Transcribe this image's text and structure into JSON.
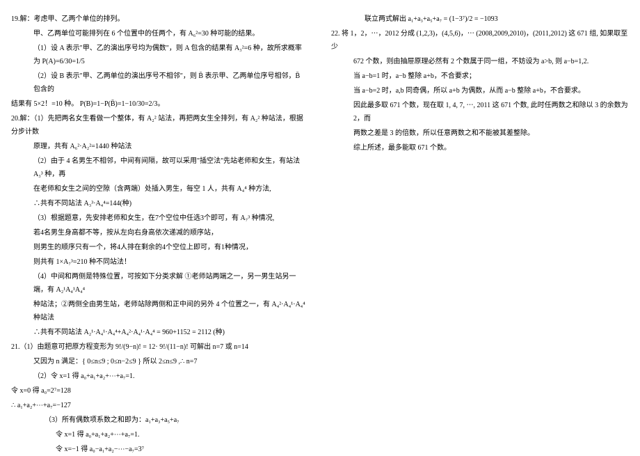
{
  "left": {
    "p19": {
      "head": "19.解：考虑甲、乙两个单位的排列。",
      "l1": "甲、乙两单位可能排列在 6 个位置中的任两个，有 A₆²=30 种可能的结果。",
      "l2": "（1）设 A 表示\"甲、乙的演出序号均为偶数\"，则 A 包含的结果有 A₃²=6 种，故所求概率为 P(A)=6/30=1/5",
      "l3": "（2）设 B 表示\"甲、乙两单位的演出序号不相邻\"，则 B̄ 表示甲、乙两单位序号相邻，B̄ 包含的",
      "l4": "结果有 5×2！=10 种。  P(B)=1−P(B̄)=1−10/30=2/3。"
    },
    "p20": {
      "l1": "20.解：（1）先把两名女生看做一个整体，有 A₂² 站法，再把两女生全排列，有 A₂² 种站法，根据分步计数",
      "l2": "原理，共有 A₆²·A₂²=1440 种站法",
      "l3": "（2）由于 4 名男生不相邻，中间有间隔，故可以采用\"插空法\"先站老师和女生，有站法 A₃³ 种，再",
      "l4": "在老师和女生之间的空隙（含两端）处插入男生，每空 1 人，共有 A₄⁴ 种方法,",
      "l5": "∴共有不同站法 A₃³·A₄⁴=144(种)",
      "l6": "（3）根据题意，先安排老师和女生，在7个空位中任选3个即可，有 A₇³ 种情况,",
      "l7": "若4名男生身高都不等，按从左向右身高依次递减的顺序站，",
      "l8": "则男生的顺序只有一个，将4人排在剩余的4个空位上即可，有1种情况，",
      "l9": "则共有 1×A₇³=210 种不同站法！",
      "l10": "（4）中间和两侧是特殊位置，可按如下分类求解 ①老师站两端之一，另一男生站另一端，有 A₂¹A₄¹A₄⁴",
      "l11": "种站法；②两侧全由男生站，老师站除两侧和正中间的另外 4 个位置之一，有 A₄²·A₄¹·A₄⁴ 种站法",
      "l12": "∴共有不同站法 A₂¹·A₄¹·A₄⁴+A₄²·A₄¹·A₄⁴ = 960+1152 = 2112 (种)"
    },
    "p21": {
      "l1": "21.（1）由题意可把原方程变形为 9!/(9−n)! = 12· 9!/(11−n)! 可解出 n=7 或 n=14",
      "l2": "又因为 n 满足：{ 0≤n≤9 ; 0≤n−2≤9 } 所以 2≤n≤9 ,∴ n=7",
      "l3": "（2）令 x=1 得 a₀+a₁+a₂+⋯+a₇=1.",
      "l4": "令 x=0 得 a₀=2⁷=128",
      "l5": "∴ a₁+a₂+⋯+a₇=−127",
      "l6": "（3）所有偶数项系数之和即为：a₁+a₃+a₅+a₇",
      "l7": "令 x=1 得 a₀+a₁+a₂+⋯+a₇=1.",
      "l8": "令 x=−1 得 a₀−a₁+a₂−⋯−a₇=3⁷"
    }
  },
  "right": {
    "top": "联立两式解出 a₁+a₃+a₅+a₇ = (1−3⁷)/2 = −1093",
    "p22": {
      "l1": "22. 将 1，2，⋯，2012 分成 (1,2,3)，(4,5,6)，⋯ (2008,2009,2010)，(2011,2012) 这 671 组, 如果取至少",
      "l2": "672 个数，则由抽屉原理必然有 2 个数属于同一组，不妨设为 a>b, 则 a−b=1,2.",
      "l3": "当 a−b=1 时，a−b 整除 a+b，不合要求；",
      "l4": "当 a−b=2 时，a,b 同奇偶，所以 a+b 为偶数，从而 a−b 整除 a+b，不合要求。",
      "l5": "因此最多取 671 个数，现在取 1, 4, 7, ⋯, 2011 这 671 个数, 此时任两数之和除以 3 的余数为 2，而",
      "l6": "两数之差是 3 的倍数，所以任意两数之和不能被其差整除。",
      "l7": "综上所述，最多能取 671 个数。"
    }
  }
}
